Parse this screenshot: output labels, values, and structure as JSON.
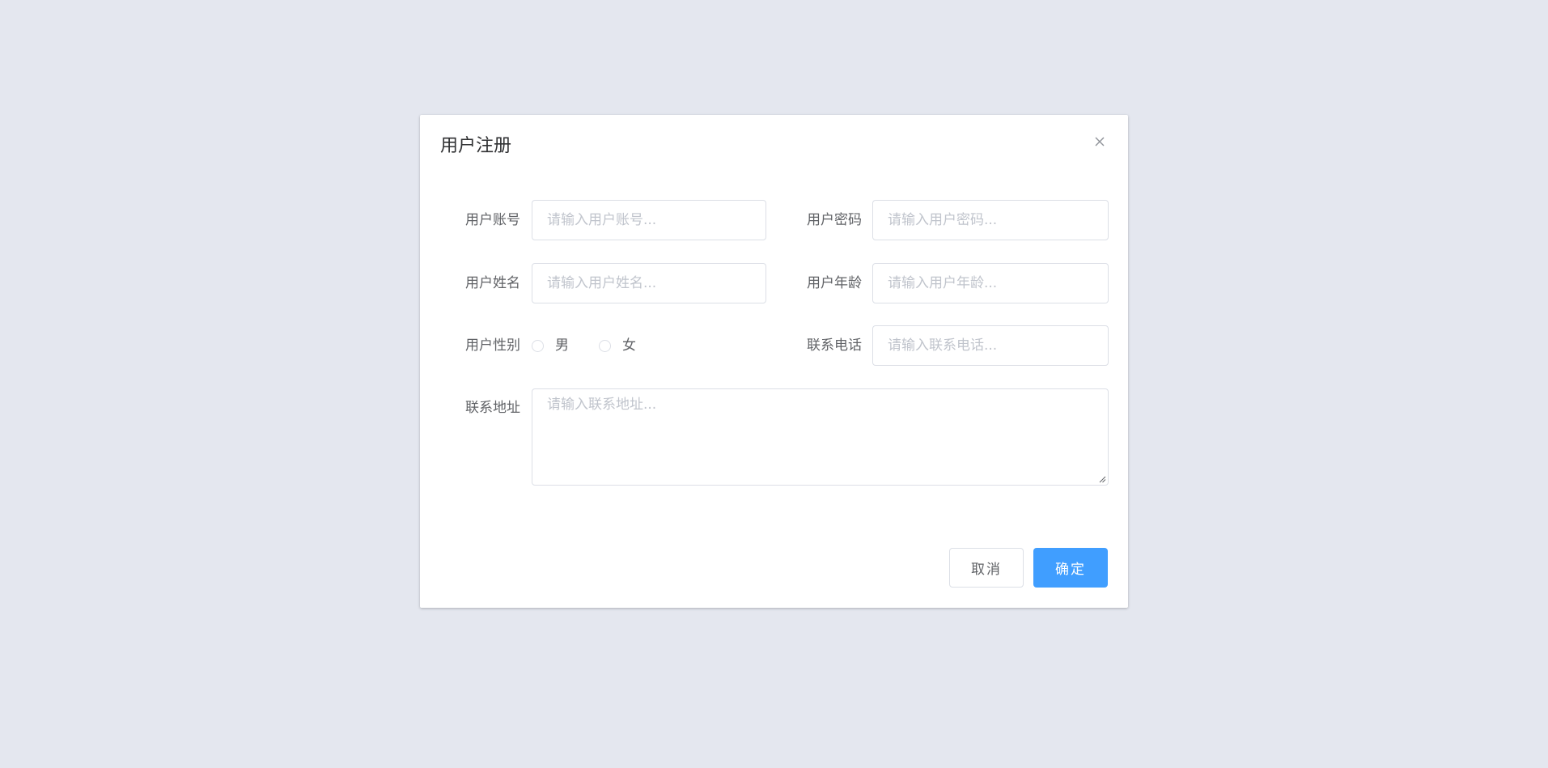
{
  "dialog": {
    "title": "用户注册"
  },
  "form": {
    "account": {
      "label": "用户账号",
      "placeholder": "请输入用户账号...",
      "value": ""
    },
    "password": {
      "label": "用户密码",
      "placeholder": "请输入用户密码...",
      "value": ""
    },
    "name": {
      "label": "用户姓名",
      "placeholder": "请输入用户姓名...",
      "value": ""
    },
    "age": {
      "label": "用户年龄",
      "placeholder": "请输入用户年龄...",
      "value": ""
    },
    "gender": {
      "label": "用户性别",
      "options": [
        "男",
        "女"
      ],
      "selected": ""
    },
    "phone": {
      "label": "联系电话",
      "placeholder": "请输入联系电话...",
      "value": ""
    },
    "address": {
      "label": "联系地址",
      "placeholder": "请输入联系地址...",
      "value": ""
    }
  },
  "footer": {
    "cancel_label": "取消",
    "confirm_label": "确定"
  },
  "colors": {
    "background": "#e4e7ef",
    "primary": "#409eff",
    "border": "#dcdfe6",
    "placeholder": "#c0c4cc",
    "text": "#606266",
    "title": "#303133"
  },
  "icons": {
    "close": "close-icon",
    "resize": "resize-handle-icon"
  }
}
